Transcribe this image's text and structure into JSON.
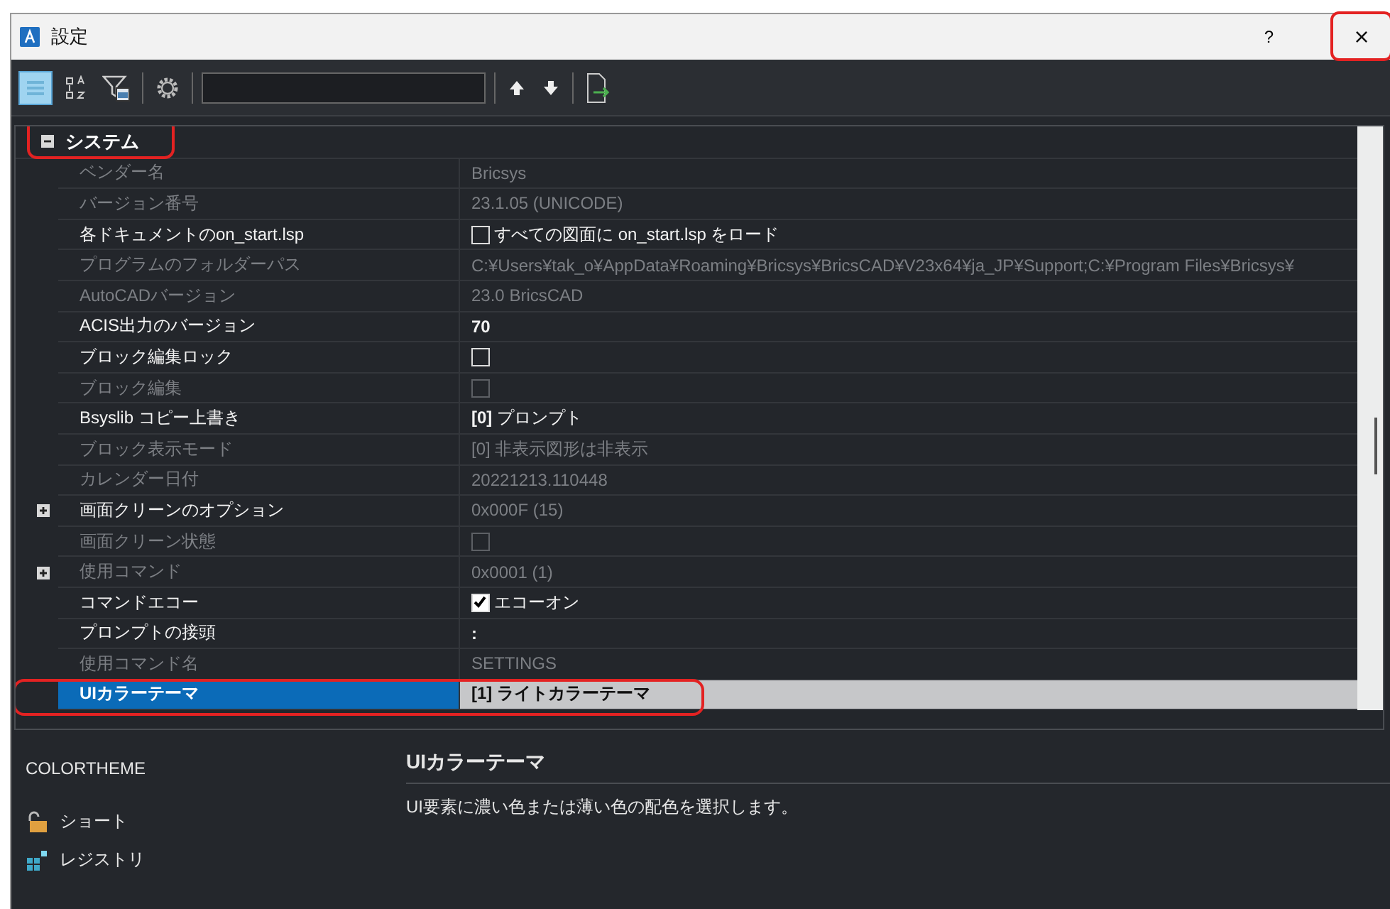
{
  "window": {
    "title": "設定",
    "help_button": "?",
    "close_button": "×",
    "close_highlighted": true
  },
  "toolbar": {
    "tools": [
      {
        "kind": "categorized",
        "selected": true
      },
      {
        "kind": "sort",
        "selected": false
      },
      {
        "kind": "filter",
        "selected": false
      },
      {
        "kind": "settings",
        "selected": false
      },
      {
        "kind": "up",
        "selected": false
      },
      {
        "kind": "down",
        "selected": false
      },
      {
        "kind": "export",
        "selected": false
      }
    ]
  },
  "category": {
    "label": "システム",
    "expanded": true,
    "highlighted": true
  },
  "rows": [
    {
      "label": "ベンダー名",
      "disabled": true,
      "kind": "text",
      "value": "Bricsys",
      "value_disabled": true,
      "selected": false
    },
    {
      "label": "バージョン番号",
      "disabled": true,
      "kind": "text",
      "value": "23.1.05 (UNICODE)",
      "value_disabled": true,
      "selected": false
    },
    {
      "label": "各ドキュメントのon_start.lsp",
      "disabled": false,
      "kind": "checkbox",
      "checked": false,
      "value": "すべての図面に on_start.lsp をロード",
      "value_disabled": false,
      "selected": false
    },
    {
      "label": "プログラムのフォルダーパス",
      "disabled": true,
      "kind": "text",
      "value": "C:¥Users¥tak_o¥AppData¥Roaming¥Bricsys¥BricsCAD¥V23x64¥ja_JP¥Support;C:¥Program Files¥Bricsys¥",
      "value_disabled": true,
      "selected": false
    },
    {
      "label": "AutoCADバージョン",
      "disabled": true,
      "kind": "text",
      "value": "23.0 BricsCAD",
      "value_disabled": true,
      "selected": false
    },
    {
      "label": "ACIS出力のバージョン",
      "disabled": false,
      "kind": "text",
      "value": "**70**",
      "value_disabled": false,
      "selected": false
    },
    {
      "label": "ブロック編集ロック",
      "disabled": false,
      "kind": "checkbox",
      "checked": false,
      "value_disabled": false,
      "selected": false
    },
    {
      "label": "ブロック編集",
      "disabled": true,
      "kind": "checkbox",
      "checked": false,
      "value_disabled": true,
      "selected": false
    },
    {
      "label": "Bsyslib コピー上書き",
      "disabled": false,
      "kind": "text",
      "value": "**[0]** プロンプト",
      "value_disabled": false,
      "selected": false
    },
    {
      "label": "ブロック表示モード",
      "disabled": true,
      "kind": "text",
      "value": "[0] 非表示図形は非表示",
      "value_disabled": true,
      "selected": false
    },
    {
      "label": "カレンダー日付",
      "disabled": true,
      "kind": "text",
      "value": "20221213.110448",
      "value_disabled": true,
      "selected": false
    },
    {
      "label": "画面クリーンのオプション",
      "disabled": false,
      "kind": "text",
      "value": "0x000F (15)",
      "value_disabled": true,
      "expanded": false,
      "selected": false
    },
    {
      "label": "画面クリーン状態",
      "disabled": true,
      "kind": "checkbox",
      "checked": false,
      "value_disabled": true,
      "selected": false
    },
    {
      "label": "使用コマンド",
      "disabled": true,
      "kind": "text",
      "value": "0x0001 (1)",
      "value_disabled": true,
      "expanded": false,
      "selected": false
    },
    {
      "label": "コマンドエコー",
      "disabled": false,
      "kind": "checkbox",
      "checked": true,
      "value": "エコーオン",
      "value_disabled": false,
      "selected": false
    },
    {
      "label": "プロンプトの接頭",
      "disabled": false,
      "kind": "text",
      "value": "**:**",
      "value_disabled": false,
      "selected": false
    },
    {
      "label": "使用コマンド名",
      "disabled": true,
      "kind": "text",
      "value": "SETTINGS",
      "value_disabled": true,
      "selected": false
    },
    {
      "label": "UIカラーテーマ",
      "disabled": false,
      "kind": "text",
      "value": "**[1]** ライトカラーテーマ",
      "value_disabled": false,
      "selected": true,
      "highlighted": true
    }
  ],
  "help_panel": {
    "name": "COLORTHEME",
    "title": "UIカラーテーマ",
    "description": "UI要素に濃い色または薄い色の配色を選択します。",
    "links": [
      {
        "kind": "short",
        "label": "ショート"
      },
      {
        "kind": "registry",
        "label": "レジストリ"
      }
    ]
  }
}
